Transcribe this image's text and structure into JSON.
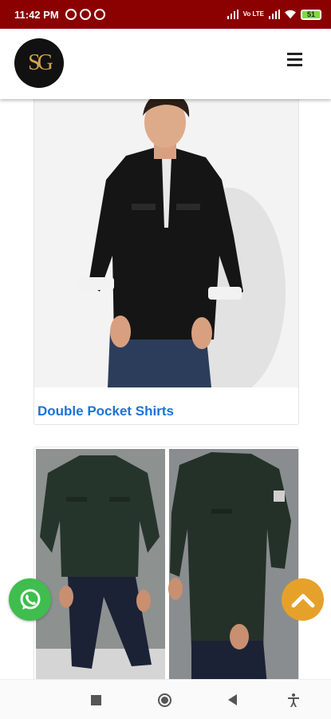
{
  "status_bar": {
    "time": "11:42 PM",
    "network": "Vo LTE",
    "battery": "51"
  },
  "header": {
    "logo_text": "SG",
    "menu_icon": "hamburger-menu-icon"
  },
  "products": [
    {
      "title": "Double Pocket Shirts",
      "image": "man-in-black-double-pocket-shirt"
    },
    {
      "title": "",
      "image": "man-in-dark-green-shirt-front-and-side-views"
    }
  ],
  "floating": {
    "whatsapp_icon": "whatsapp-icon",
    "scroll_top_icon": "chevron-up-icon"
  },
  "nav_bar": [
    "recents-button",
    "home-button",
    "back-button",
    "accessibility-button"
  ],
  "colors": {
    "status_bar_bg": "#8b0000",
    "title_blue": "#1a73d9",
    "whatsapp_green": "#3fbd4e",
    "scroll_top_orange": "#e6a12a"
  }
}
